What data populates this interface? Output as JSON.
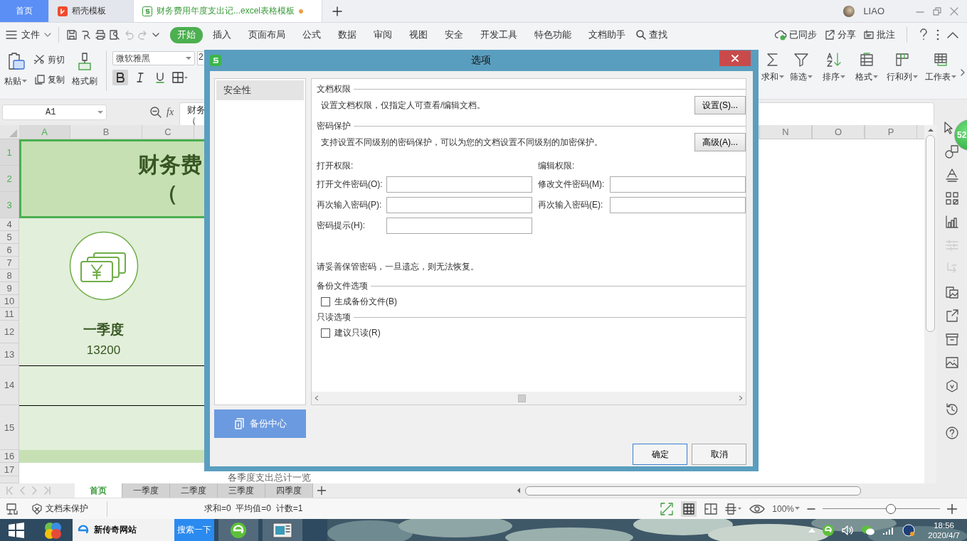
{
  "tabs": [
    {
      "label": "首页",
      "kind": "home",
      "selected": false,
      "unsaved": false
    },
    {
      "label": "稻壳模板",
      "kind": "docer",
      "selected": false,
      "unsaved": false
    },
    {
      "label": "财务费用年度支出记...excel表格模板",
      "kind": "sheet",
      "selected": true,
      "unsaved": true
    }
  ],
  "user": {
    "name": "LIAO"
  },
  "menu": {
    "file": "文件",
    "items": [
      {
        "label": "开始",
        "selected": true
      },
      {
        "label": "插入",
        "selected": false
      },
      {
        "label": "页面布局",
        "selected": false
      },
      {
        "label": "公式",
        "selected": false
      },
      {
        "label": "数据",
        "selected": false
      },
      {
        "label": "审阅",
        "selected": false
      },
      {
        "label": "视图",
        "selected": false
      },
      {
        "label": "安全",
        "selected": false
      },
      {
        "label": "开发工具",
        "selected": false
      },
      {
        "label": "特色功能",
        "selected": false
      },
      {
        "label": "文档助手",
        "selected": false
      }
    ],
    "search": "查找",
    "right": [
      {
        "label": "已同步",
        "kind": "sync"
      },
      {
        "label": "分享",
        "kind": "share"
      },
      {
        "label": "批注",
        "kind": "comment"
      }
    ]
  },
  "ribbon": {
    "paste": "粘贴",
    "cut": "剪切",
    "copy": "复制",
    "format_painter": "格式刷",
    "font": "微软雅黑",
    "font_size": "2",
    "bold_on": true,
    "right": [
      {
        "label": "求和",
        "kind": "sum"
      },
      {
        "label": "筛选",
        "kind": "filter"
      },
      {
        "label": "排序",
        "kind": "sort"
      },
      {
        "label": "格式",
        "kind": "format"
      },
      {
        "label": "行和列",
        "kind": "rowcol"
      },
      {
        "label": "工作表",
        "kind": "sheet"
      }
    ]
  },
  "formula_bar": {
    "cell": "A1",
    "fx": "fx",
    "content_lines": [
      "财务",
      "（"
    ]
  },
  "sheet": {
    "columns_left": [
      "A",
      "B",
      "C"
    ],
    "columns_right": [
      "N",
      "O",
      "P"
    ],
    "rows": [
      "1",
      "2",
      "3",
      "4",
      "5",
      "6",
      "7",
      "8",
      "9",
      "10",
      "11",
      "12",
      "13",
      "14",
      "15",
      "16",
      "17"
    ],
    "title": "财务费",
    "subtitle": "（",
    "quarter_label": "一季度",
    "quarter_value": "13200",
    "caption": "各季度支出总计一览"
  },
  "floating_badge": "52",
  "sheet_tabs": [
    {
      "label": "首页",
      "selected": true
    },
    {
      "label": "一季度",
      "selected": false
    },
    {
      "label": "二季度",
      "selected": false
    },
    {
      "label": "三季度",
      "selected": false
    },
    {
      "label": "四季度",
      "selected": false
    }
  ],
  "dialog": {
    "title": "选项",
    "nav": [
      {
        "label": "安全性",
        "selected": true
      }
    ],
    "backup_button": "备份中心",
    "doc_rights": {
      "heading": "文档权限",
      "text": "设置文档权限，仅指定人可查看/编辑文档。",
      "button": "设置(S)..."
    },
    "password": {
      "heading": "密码保护",
      "text": "支持设置不同级别的密码保护，可以为您的文档设置不同级别的加密保护。",
      "button": "高级(A)..."
    },
    "open_rights": {
      "heading": "打开权限:",
      "fields": [
        "打开文件密码(O):",
        "再次输入密码(P):",
        "密码提示(H):"
      ]
    },
    "edit_rights": {
      "heading": "编辑权限:",
      "fields": [
        "修改文件密码(M):",
        "再次输入密码(E):"
      ]
    },
    "note": "请妥善保管密码，一旦遗忘，则无法恢复。",
    "options": [
      {
        "heading": "备份文件选项",
        "label": "生成备份文件(B)",
        "checked": false
      },
      {
        "heading": "只读选项",
        "label": "建议只读(R)",
        "checked": false
      }
    ],
    "ok": "确定",
    "cancel": "取消"
  },
  "status_bar": {
    "protection": "文档未保护",
    "stats": "求和=0  平均值=0  计数=1",
    "zoom": "100%",
    "zoom_slider": {
      "level": 0.58
    }
  },
  "taskbar": {
    "search_value": "新传奇网站",
    "search_button": "搜索一下",
    "time": "18:56",
    "date": "2020/4/7"
  }
}
